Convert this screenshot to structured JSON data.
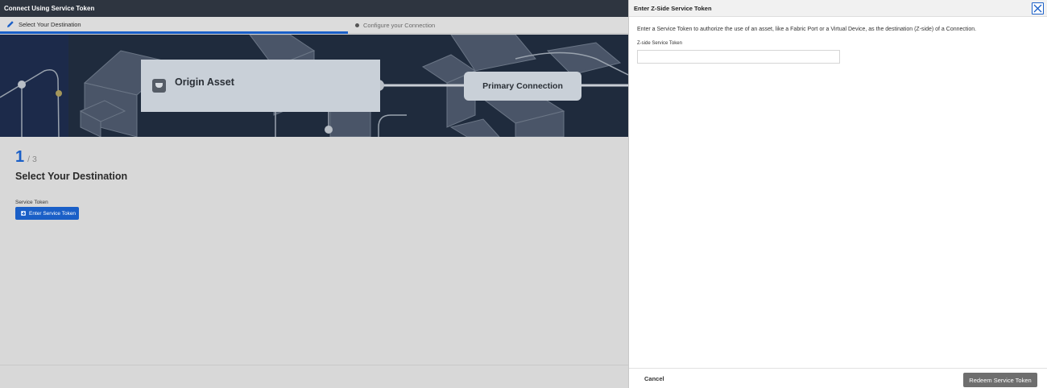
{
  "window": {
    "title": "Connect Using Service Token"
  },
  "steps": [
    {
      "label": "Select Your Destination",
      "active": true
    },
    {
      "label": "Configure your Connection",
      "active": false
    }
  ],
  "hero": {
    "origin_label": "Origin Asset",
    "primary_label": "Primary Connection"
  },
  "main": {
    "step_current": "1",
    "step_total": "/ 3",
    "section_title": "Select Your Destination",
    "token_label": "Service Token",
    "enter_token_button": "Enter Service Token"
  },
  "drawer": {
    "title": "Enter Z-Side Service Token",
    "description": "Enter a Service Token to authorize the use of an asset, like a Fabric Port or a Virtual Device, as the destination (Z-side) of a Connection.",
    "field_label": "Z-side Service Token",
    "field_value": "",
    "field_placeholder": "",
    "cancel_label": "Cancel",
    "redeem_label": "Redeem Service Token"
  },
  "colors": {
    "accent": "#1a5fc7",
    "topbar": "#2e3540",
    "hero_bg": "#1f2b3d",
    "disabled_button": "#6e6e6e"
  },
  "icons": {
    "step1": "pencil-icon",
    "step2": "dot-icon",
    "origin": "port-icon",
    "enter_token": "plus-square-icon",
    "close": "close-icon"
  }
}
